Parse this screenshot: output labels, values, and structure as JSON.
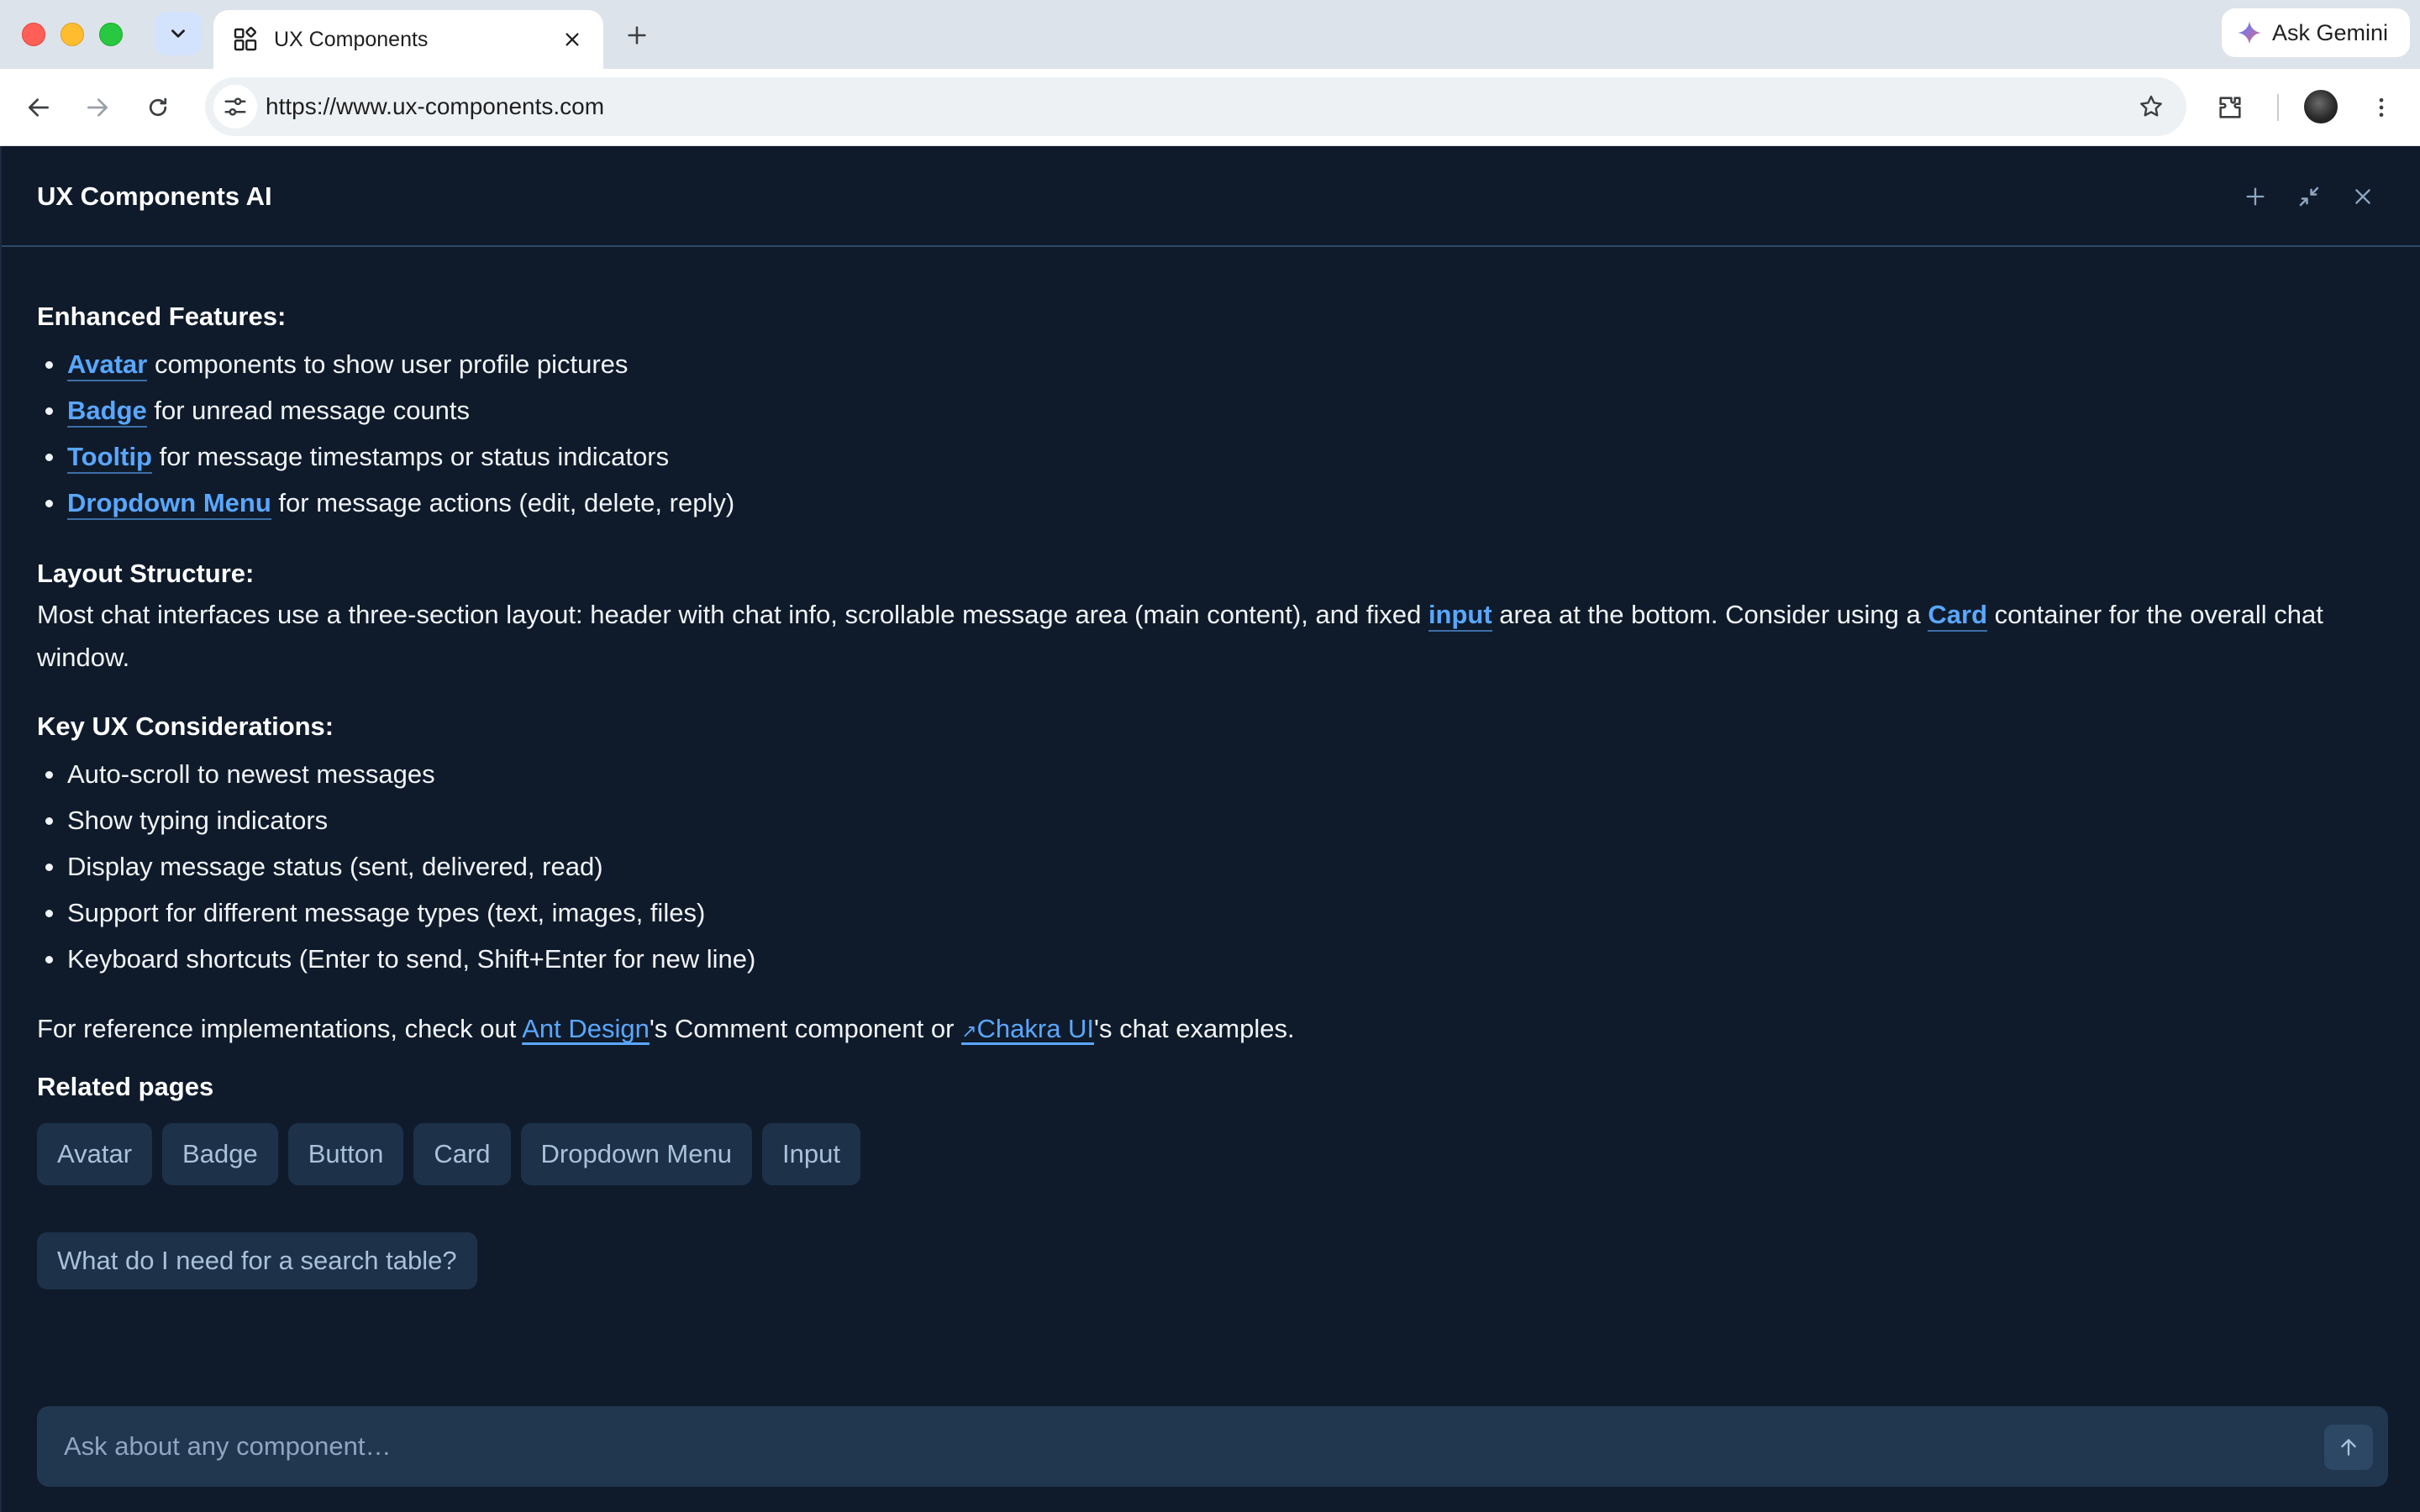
{
  "browser": {
    "tab_title": "UX Components",
    "url": "https://www.ux-components.com",
    "ask_gemini_label": "Ask Gemini"
  },
  "panel": {
    "title": "UX Components AI"
  },
  "content": {
    "enhanced": {
      "title": "Enhanced Features:",
      "items": [
        {
          "link": "Avatar",
          "text": " components to show user profile pictures"
        },
        {
          "link": "Badge",
          "text": " for unread message counts"
        },
        {
          "link": "Tooltip",
          "text": " for message timestamps or status indicators"
        },
        {
          "link": "Dropdown Menu",
          "text": " for message actions (edit, delete, reply)"
        }
      ]
    },
    "layout": {
      "title": "Layout Structure:",
      "text_1": "Most chat interfaces use a three-section layout: header with chat info, scrollable message area (main content), and fixed ",
      "link_1": "input",
      "text_2": " area at the bottom. Consider using a ",
      "link_2": "Card",
      "text_3": " container for the overall chat window."
    },
    "ux": {
      "title": "Key UX Considerations:",
      "items": [
        "Auto-scroll to newest messages",
        "Show typing indicators",
        "Display message status (sent, delivered, read)",
        "Support for different message types (text, images, files)",
        "Keyboard shortcuts (Enter to send, Shift+Enter for new line)"
      ]
    },
    "reference": {
      "text_1": "For reference implementations, check out ",
      "link_1": "Ant Design",
      "text_2": "'s Comment component or ",
      "arrow": "↗",
      "link_2": "Chakra UI",
      "text_3": "'s chat examples."
    },
    "related": {
      "title": "Related pages",
      "chips": [
        "Avatar",
        "Badge",
        "Button",
        "Card",
        "Dropdown Menu",
        "Input"
      ]
    },
    "suggestion": "What do I need for a search table?"
  },
  "input": {
    "placeholder": "Ask about any component…"
  },
  "colors": {
    "panel_bg": "#0f1b2b",
    "link": "#5aa7ff",
    "chip_bg": "#1d3149",
    "input_bg": "#21364f"
  },
  "icons": [
    "chevron-down-icon",
    "tab-components-icon",
    "close-icon",
    "plus-icon",
    "gemini-icon",
    "back-icon",
    "forward-icon",
    "reload-icon",
    "site-info-icon",
    "star-icon",
    "extensions-icon",
    "menu-icon",
    "new-chat-icon",
    "minimize-icon",
    "arrow-up-icon"
  ]
}
